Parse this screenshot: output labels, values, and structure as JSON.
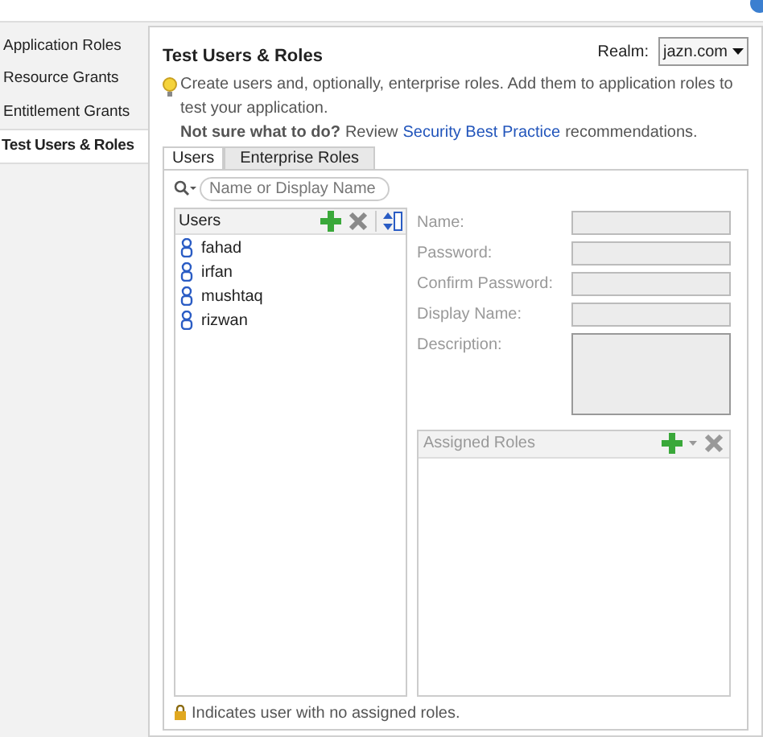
{
  "sidebar": {
    "items": [
      {
        "label": "Application Roles",
        "selected": false
      },
      {
        "label": "Resource Grants",
        "selected": false
      },
      {
        "label": "Entitlement Grants",
        "selected": false
      },
      {
        "label": "Test Users & Roles",
        "selected": true
      }
    ]
  },
  "header": {
    "title": "Test Users & Roles",
    "realm_label": "Realm:",
    "realm_value": "jazn.com"
  },
  "hint": {
    "text": "Create users and, optionally, enterprise roles. Add them to application roles to test your application.",
    "help_lead": "Not sure what to do?",
    "help_pre": "Review",
    "help_link": "Security Best Practice",
    "help_post": "recommendations."
  },
  "tabs": [
    {
      "label": "Users",
      "selected": true
    },
    {
      "label": "Enterprise Roles",
      "selected": false
    }
  ],
  "search": {
    "placeholder": "Name or Display Name"
  },
  "users": {
    "title": "Users",
    "items": [
      "fahad",
      "irfan",
      "mushtaq",
      "rizwan"
    ]
  },
  "form": {
    "fields": [
      {
        "label": "Name:",
        "kind": "text",
        "disabled": true
      },
      {
        "label": "Password:",
        "kind": "text",
        "disabled": true
      },
      {
        "label": "Confirm Password:",
        "kind": "text",
        "disabled": true
      },
      {
        "label": "Display Name:",
        "kind": "text",
        "disabled": true
      },
      {
        "label": "Description:",
        "kind": "area",
        "disabled": true
      }
    ]
  },
  "assigned_roles": {
    "title": "Assigned Roles"
  },
  "legend": "Indicates user with no assigned roles."
}
